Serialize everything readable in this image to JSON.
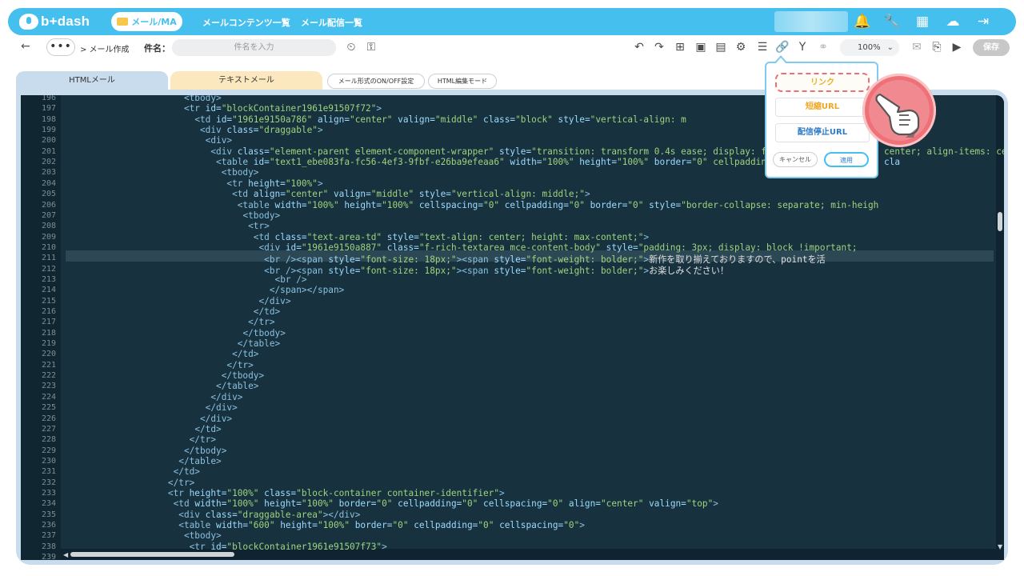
{
  "header": {
    "logo": "b+dash",
    "module": "メール/MA",
    "nav": [
      "メールコンテンツ一覧",
      "メール配信一覧"
    ]
  },
  "toolbar": {
    "dots": "•••",
    "breadcrumb": "> メール作成",
    "subject_label": "件名：",
    "subject_placeholder": "件名を入力",
    "zoom": "100%",
    "save": "保存"
  },
  "tabs": {
    "html": "HTMLメール",
    "text": "テキストメール",
    "toggle": "メール形式のON/OFF設定",
    "html_mode": "HTML編集モード"
  },
  "popup": {
    "link": "リンク",
    "short_url": "短縮URL",
    "unsubscribe_url": "配信停止URL",
    "cancel": "キャンセル",
    "apply": "適用"
  },
  "editor": {
    "highlight_line": 211,
    "lines": [
      {
        "n": "196",
        "indent": 22,
        "parts": [
          [
            "t",
            "<tbody>"
          ]
        ]
      },
      {
        "n": "197",
        "indent": 22,
        "parts": [
          [
            "t",
            "<tr "
          ],
          [
            "a",
            "id="
          ],
          [
            "s",
            "\"blockContainer1961e91507f72\""
          ],
          [
            "t",
            ">"
          ]
        ]
      },
      {
        "n": "198",
        "indent": 24,
        "parts": [
          [
            "t",
            "<td "
          ],
          [
            "a",
            "id="
          ],
          [
            "s",
            "\"1961e9150a786\""
          ],
          [
            "a",
            " align="
          ],
          [
            "s",
            "\"center\""
          ],
          [
            "a",
            " valign="
          ],
          [
            "s",
            "\"middle\""
          ],
          [
            "a",
            " class="
          ],
          [
            "s",
            "\"block\""
          ],
          [
            "a",
            " style="
          ],
          [
            "s",
            "\"vertical-align: m"
          ]
        ]
      },
      {
        "n": "199",
        "indent": 25,
        "parts": [
          [
            "t",
            "<div "
          ],
          [
            "a",
            "class="
          ],
          [
            "s",
            "\"draggable\""
          ],
          [
            "t",
            ">"
          ]
        ]
      },
      {
        "n": "200",
        "indent": 26,
        "parts": [
          [
            "t",
            "<div>"
          ]
        ]
      },
      {
        "n": "201",
        "indent": 27,
        "parts": [
          [
            "t",
            "<div "
          ],
          [
            "a",
            "class="
          ],
          [
            "s",
            "\"element-parent element-component-wrapper\""
          ],
          [
            "a",
            " style="
          ],
          [
            "s",
            "\"transition: transform 0.4s ease; display: flex; justify-content: center; align-items: cent"
          ]
        ]
      },
      {
        "n": "202",
        "indent": 28,
        "parts": [
          [
            "t",
            "<table "
          ],
          [
            "a",
            "id="
          ],
          [
            "s",
            "\"text1_ebe083fa-fc56-4ef3-9fbf-e26ba9efeaa6\""
          ],
          [
            "a",
            " width="
          ],
          [
            "s",
            "\"100%\""
          ],
          [
            "a",
            " height="
          ],
          [
            "s",
            "\"100%\""
          ],
          [
            "a",
            " border="
          ],
          [
            "s",
            "\"0\" cellpadding=\"0\""
          ],
          [
            "a",
            " cellspacing="
          ],
          [
            "s",
            "\"0\""
          ],
          [
            "a",
            " cla"
          ]
        ]
      },
      {
        "n": "203",
        "indent": 29,
        "parts": [
          [
            "t",
            "<tbody>"
          ]
        ]
      },
      {
        "n": "204",
        "indent": 30,
        "parts": [
          [
            "t",
            "<tr "
          ],
          [
            "a",
            "height="
          ],
          [
            "s",
            "\"100%\""
          ],
          [
            "t",
            ">"
          ]
        ]
      },
      {
        "n": "205",
        "indent": 31,
        "parts": [
          [
            "t",
            "<td "
          ],
          [
            "a",
            "align="
          ],
          [
            "s",
            "\"center\""
          ],
          [
            "a",
            " valign="
          ],
          [
            "s",
            "\"middle\""
          ],
          [
            "a",
            " style="
          ],
          [
            "s",
            "\"vertical-align: middle;\""
          ],
          [
            "t",
            ">"
          ]
        ]
      },
      {
        "n": "206",
        "indent": 32,
        "parts": [
          [
            "t",
            "<table "
          ],
          [
            "a",
            "width="
          ],
          [
            "s",
            "\"100%\""
          ],
          [
            "a",
            " height="
          ],
          [
            "s",
            "\"100%\""
          ],
          [
            "a",
            " cellspacing="
          ],
          [
            "s",
            "\"0\""
          ],
          [
            "a",
            " cellpadding="
          ],
          [
            "s",
            "\"0\""
          ],
          [
            "a",
            " border="
          ],
          [
            "s",
            "\"0\""
          ],
          [
            "a",
            " style="
          ],
          [
            "s",
            "\"border-collapse: separate; min-heigh"
          ]
        ]
      },
      {
        "n": "207",
        "indent": 33,
        "parts": [
          [
            "t",
            "<tbody>"
          ]
        ]
      },
      {
        "n": "208",
        "indent": 34,
        "parts": [
          [
            "t",
            "<tr>"
          ]
        ]
      },
      {
        "n": "209",
        "indent": 35,
        "parts": [
          [
            "t",
            "<td "
          ],
          [
            "a",
            "class="
          ],
          [
            "s",
            "\"text-area-td\""
          ],
          [
            "a",
            " style="
          ],
          [
            "s",
            "\"text-align: center; height: max-content;\""
          ],
          [
            "t",
            ">"
          ]
        ]
      },
      {
        "n": "210",
        "indent": 36,
        "parts": [
          [
            "t",
            "<div "
          ],
          [
            "a",
            "id="
          ],
          [
            "s",
            "\"1961e9150a887\""
          ],
          [
            "a",
            " class="
          ],
          [
            "s",
            "\"f-rich-textarea mce-content-body\""
          ],
          [
            "a",
            " style="
          ],
          [
            "s",
            "\"padding: 3px; display: block !important;"
          ]
        ]
      },
      {
        "n": "211",
        "indent": 37,
        "parts": [
          [
            "t",
            "<br /><span "
          ],
          [
            "a",
            "style="
          ],
          [
            "s",
            "\"font-size: 18px;\""
          ],
          [
            "t",
            "><span "
          ],
          [
            "a",
            "style="
          ],
          [
            "s",
            "\"font-weight: bolder;\""
          ],
          [
            "t",
            ">"
          ],
          [
            "x",
            "新作を取り揃えておりますので、pointを活"
          ]
        ]
      },
      {
        "n": "212",
        "indent": 37,
        "parts": [
          [
            "t",
            "<br /><span "
          ],
          [
            "a",
            "style="
          ],
          [
            "s",
            "\"font-size: 18px;\""
          ],
          [
            "t",
            "><span "
          ],
          [
            "a",
            "style="
          ],
          [
            "s",
            "\"font-weight: bolder;\""
          ],
          [
            "t",
            ">"
          ],
          [
            "x",
            "お楽しみください！"
          ]
        ]
      },
      {
        "n": "213",
        "indent": 39,
        "parts": [
          [
            "t",
            "<br />"
          ]
        ]
      },
      {
        "n": "214",
        "indent": 38,
        "parts": [
          [
            "t",
            "</span></span>"
          ]
        ]
      },
      {
        "n": "215",
        "indent": 36,
        "parts": [
          [
            "t",
            "</div>"
          ]
        ]
      },
      {
        "n": "216",
        "indent": 35,
        "parts": [
          [
            "t",
            "</td>"
          ]
        ]
      },
      {
        "n": "217",
        "indent": 34,
        "parts": [
          [
            "t",
            "</tr>"
          ]
        ]
      },
      {
        "n": "218",
        "indent": 33,
        "parts": [
          [
            "t",
            "</tbody>"
          ]
        ]
      },
      {
        "n": "219",
        "indent": 32,
        "parts": [
          [
            "t",
            "</table>"
          ]
        ]
      },
      {
        "n": "220",
        "indent": 31,
        "parts": [
          [
            "t",
            "</td>"
          ]
        ]
      },
      {
        "n": "221",
        "indent": 30,
        "parts": [
          [
            "t",
            "</tr>"
          ]
        ]
      },
      {
        "n": "222",
        "indent": 29,
        "parts": [
          [
            "t",
            "</tbody>"
          ]
        ]
      },
      {
        "n": "223",
        "indent": 28,
        "parts": [
          [
            "t",
            "</table>"
          ]
        ]
      },
      {
        "n": "224",
        "indent": 27,
        "parts": [
          [
            "t",
            "</div>"
          ]
        ]
      },
      {
        "n": "225",
        "indent": 26,
        "parts": [
          [
            "t",
            "</div>"
          ]
        ]
      },
      {
        "n": "226",
        "indent": 25,
        "parts": [
          [
            "t",
            "</div>"
          ]
        ]
      },
      {
        "n": "227",
        "indent": 24,
        "parts": [
          [
            "t",
            "</td>"
          ]
        ]
      },
      {
        "n": "228",
        "indent": 23,
        "parts": [
          [
            "t",
            "</tr>"
          ]
        ]
      },
      {
        "n": "229",
        "indent": 22,
        "parts": [
          [
            "t",
            "</tbody>"
          ]
        ]
      },
      {
        "n": "230",
        "indent": 21,
        "parts": [
          [
            "t",
            "</table>"
          ]
        ]
      },
      {
        "n": "231",
        "indent": 20,
        "parts": [
          [
            "t",
            "</td>"
          ]
        ]
      },
      {
        "n": "232",
        "indent": 19,
        "parts": [
          [
            "t",
            "</tr>"
          ]
        ]
      },
      {
        "n": "233",
        "indent": 19,
        "parts": [
          [
            "t",
            "<tr "
          ],
          [
            "a",
            "height="
          ],
          [
            "s",
            "\"100%\""
          ],
          [
            "a",
            " class="
          ],
          [
            "s",
            "\"block-container container-identifier\""
          ],
          [
            "t",
            ">"
          ]
        ]
      },
      {
        "n": "234",
        "indent": 20,
        "parts": [
          [
            "t",
            "<td "
          ],
          [
            "a",
            "width="
          ],
          [
            "s",
            "\"100%\""
          ],
          [
            "a",
            " height="
          ],
          [
            "s",
            "\"100%\""
          ],
          [
            "a",
            " border="
          ],
          [
            "s",
            "\"0\""
          ],
          [
            "a",
            " cellpadding="
          ],
          [
            "s",
            "\"0\""
          ],
          [
            "a",
            " cellspacing="
          ],
          [
            "s",
            "\"0\""
          ],
          [
            "a",
            " align="
          ],
          [
            "s",
            "\"center\""
          ],
          [
            "a",
            " valign="
          ],
          [
            "s",
            "\"top\""
          ],
          [
            "t",
            ">"
          ]
        ]
      },
      {
        "n": "235",
        "indent": 21,
        "parts": [
          [
            "t",
            "<div "
          ],
          [
            "a",
            "class="
          ],
          [
            "s",
            "\"draggable-area\""
          ],
          [
            "t",
            "></div>"
          ]
        ]
      },
      {
        "n": "236",
        "indent": 21,
        "parts": [
          [
            "t",
            "<table "
          ],
          [
            "a",
            "width="
          ],
          [
            "s",
            "\"600\""
          ],
          [
            "a",
            " height="
          ],
          [
            "s",
            "\"100%\""
          ],
          [
            "a",
            " border="
          ],
          [
            "s",
            "\"0\""
          ],
          [
            "a",
            " cellpadding="
          ],
          [
            "s",
            "\"0\""
          ],
          [
            "a",
            " cellspacing="
          ],
          [
            "s",
            "\"0\""
          ],
          [
            "t",
            ">"
          ]
        ]
      },
      {
        "n": "237",
        "indent": 22,
        "parts": [
          [
            "t",
            "<tbody>"
          ]
        ]
      },
      {
        "n": "238",
        "indent": 23,
        "parts": [
          [
            "t",
            "<tr "
          ],
          [
            "a",
            "id="
          ],
          [
            "s",
            "\"blockContainer1961e91507f73\""
          ],
          [
            "t",
            ">"
          ]
        ]
      },
      {
        "n": "239",
        "indent": 24,
        "parts": []
      }
    ]
  }
}
